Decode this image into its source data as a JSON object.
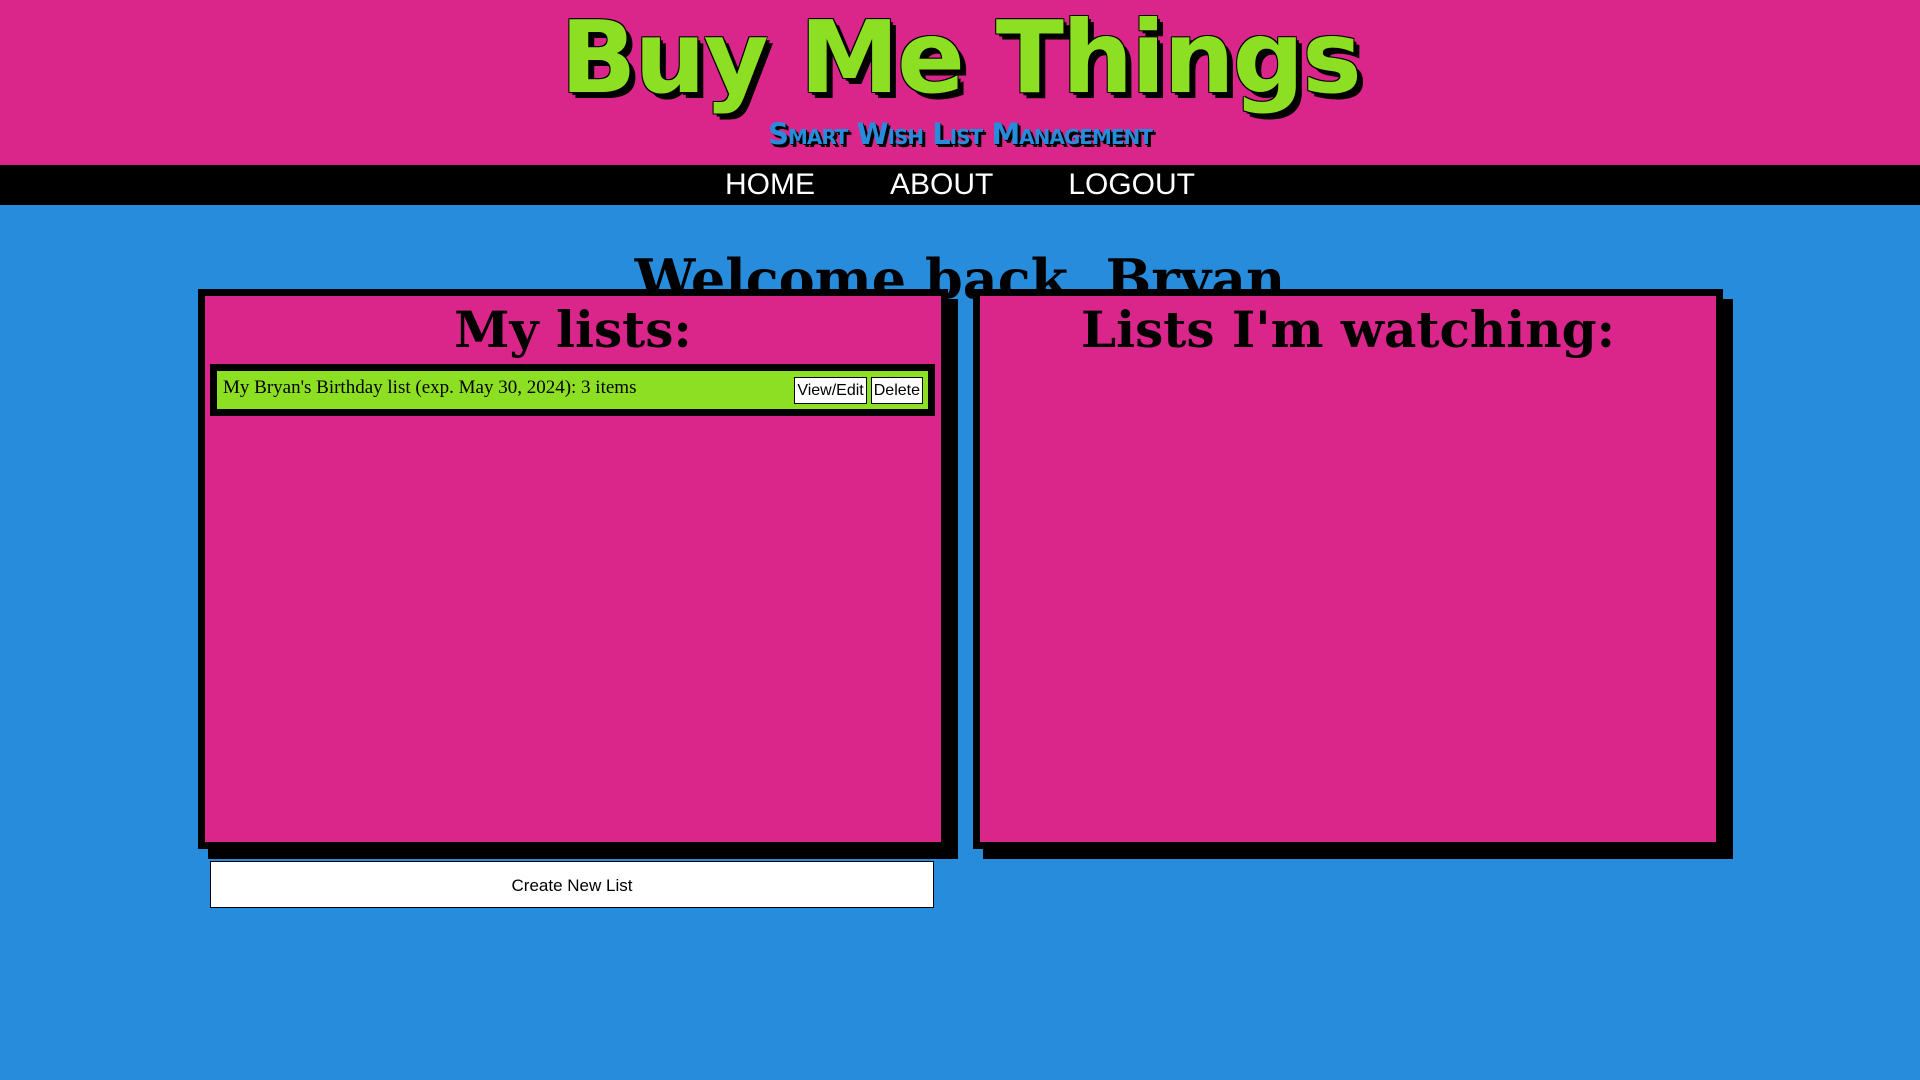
{
  "header": {
    "title": "Buy Me Things",
    "subtitle": "Smart Wish List Management"
  },
  "nav": {
    "items": [
      {
        "label": "HOME"
      },
      {
        "label": "ABOUT"
      },
      {
        "label": "LOGOUT"
      }
    ]
  },
  "main": {
    "welcome": "Welcome back, Bryan",
    "my_lists": {
      "title": "My lists:",
      "items": [
        {
          "text": "My Bryan's Birthday list (exp. May 30, 2024): 3 items",
          "view_edit_label": "View/Edit",
          "delete_label": "Delete"
        }
      ]
    },
    "watching": {
      "title": "Lists I'm watching:"
    },
    "create_button": "Create New List"
  },
  "colors": {
    "background": "#268cdb",
    "header": "#da258a",
    "accent": "#8ddf24",
    "nav": "#000000"
  }
}
